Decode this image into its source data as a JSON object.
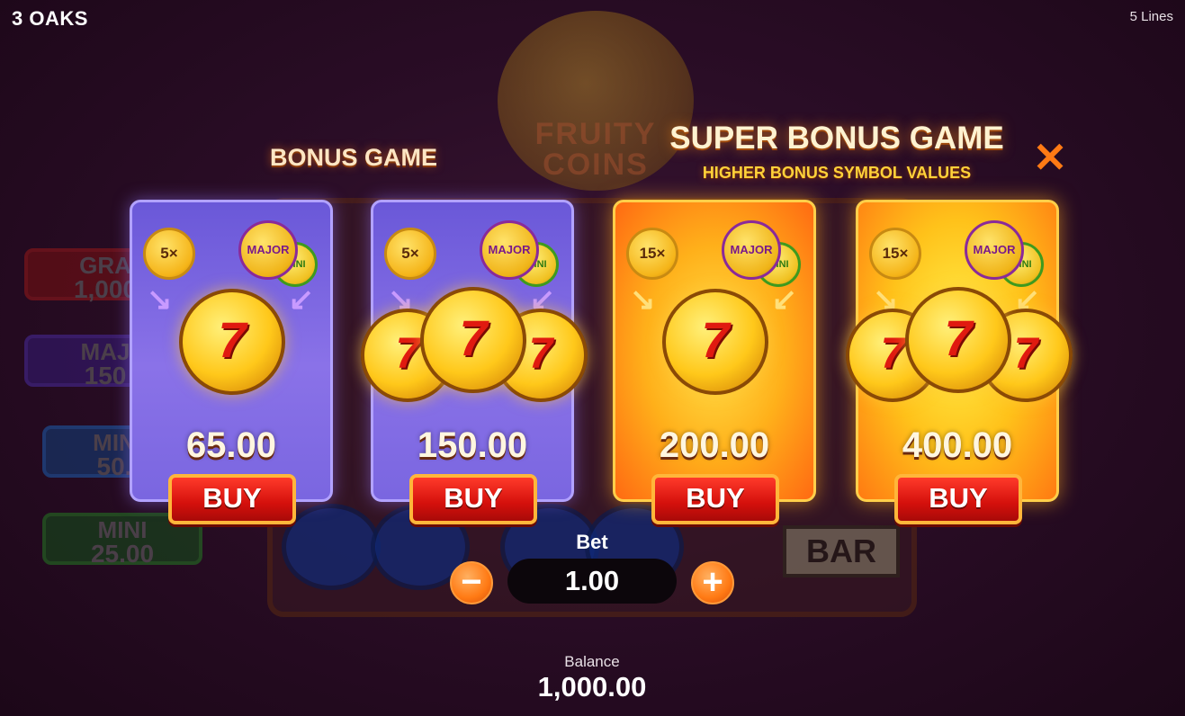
{
  "header": {
    "brand": "3 OAKS",
    "lines": "5 Lines"
  },
  "background": {
    "logo_text_1": "FRUITY",
    "logo_text_2": "COINS",
    "bar_symbol": "BAR",
    "jackpots": [
      {
        "name": "GRA",
        "value": "1,000"
      },
      {
        "name": "MAJ",
        "value": "150"
      },
      {
        "name": "MIN",
        "value": "50."
      },
      {
        "name": "MINI",
        "value": "25.00"
      }
    ]
  },
  "dialog": {
    "bonus_heading": "BONUS GAME",
    "super_heading": "SUPER BONUS GAME",
    "super_subheading": "HIGHER BONUS SYMBOL VALUES",
    "close_icon": "close-icon",
    "cards": [
      {
        "multiplier": "5×",
        "chip_major": "MAJOR",
        "chip_mini": "MINI",
        "coin_symbol": "7",
        "price": "65.00",
        "buy_label": "BUY",
        "style": "purple"
      },
      {
        "multiplier": "5×",
        "chip_major": "MAJOR",
        "chip_mini": "MINI",
        "coin_symbol": "7",
        "price": "150.00",
        "buy_label": "BUY",
        "style": "purple"
      },
      {
        "multiplier": "15×",
        "chip_major": "MAJOR",
        "chip_mini": "MINI",
        "coin_symbol": "7",
        "price": "200.00",
        "buy_label": "BUY",
        "style": "orange"
      },
      {
        "multiplier": "15×",
        "chip_major": "MAJOR",
        "chip_mini": "MINI",
        "coin_symbol": "7",
        "price": "400.00",
        "buy_label": "BUY",
        "style": "orange"
      }
    ]
  },
  "bet": {
    "label": "Bet",
    "value": "1.00",
    "minus": "−",
    "plus": "+"
  },
  "balance": {
    "label": "Balance",
    "value": "1,000.00"
  },
  "colors": {
    "accent_orange": "#ff7a14",
    "buy_red": "#d4100c",
    "purple_card": "#7a66e0",
    "orange_card": "#ffb01a"
  }
}
